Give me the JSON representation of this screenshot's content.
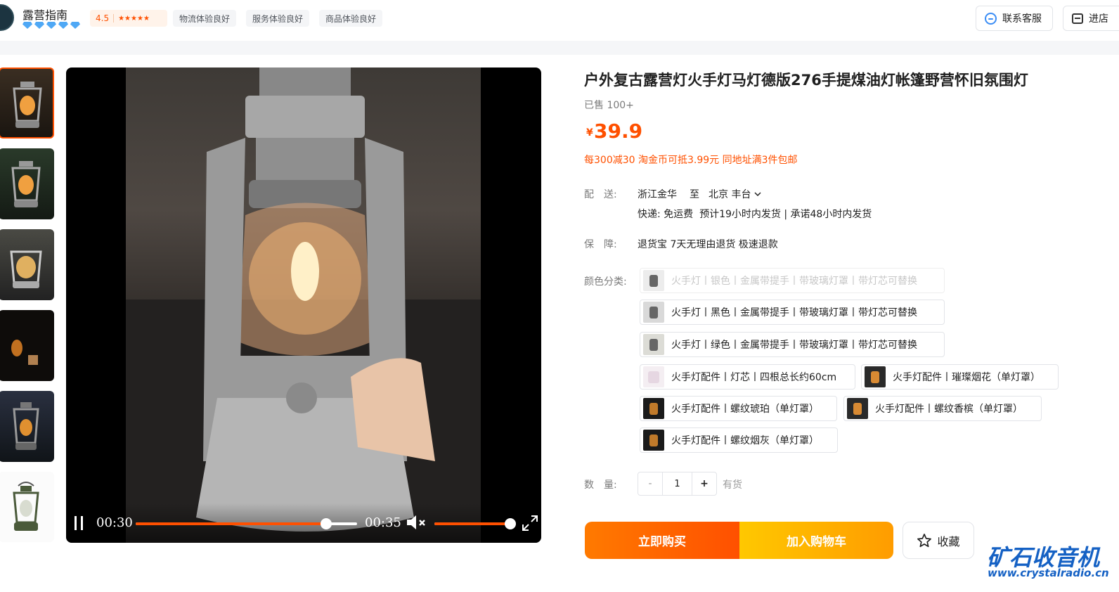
{
  "header": {
    "shop_name": "露营指南",
    "rating": "4.5",
    "stars": "★★★★★",
    "tags": [
      "物流体验良好",
      "服务体验良好",
      "商品体验良好"
    ],
    "contact_label": "联系客服",
    "enter_shop_label": "进店"
  },
  "video": {
    "current_time": "00:30",
    "duration": "00:35",
    "progress": 0.86,
    "volume": 1.0,
    "playing": true
  },
  "product": {
    "title": "户外复古露营灯火手灯马灯德版276手提煤油灯帐篷野营怀旧氛围灯",
    "sold": "已售 100+",
    "currency": "¥",
    "price": "39.9",
    "promo": "每300减30 淘金币可抵3.99元 同地址满3件包邮"
  },
  "delivery": {
    "label": "配　送:",
    "from": "浙江金华",
    "to_word": "至",
    "to": "北京 丰台",
    "detail": "快递: 免运费  预计19小时内发货 | 承诺48小时内发货"
  },
  "guarantee": {
    "label": "保　障:",
    "text": "退货宝 7天无理由退货 极速退款"
  },
  "color": {
    "label": "颜色分类:",
    "options": [
      "火手灯丨银色丨金属带提手丨带玻璃灯罩丨带灯芯可替换",
      "火手灯丨黑色丨金属带提手丨带玻璃灯罩丨带灯芯可替换",
      "火手灯丨绿色丨金属带提手丨带玻璃灯罩丨带灯芯可替换",
      "火手灯配件丨灯芯丨四根总长约60cm",
      "火手灯配件丨璀璨烟花（单灯罩）",
      "火手灯配件丨螺纹琥珀（单灯罩）",
      "火手灯配件丨螺纹香槟（单灯罩）",
      "火手灯配件丨螺纹烟灰（单灯罩）"
    ],
    "disabled_index": 0
  },
  "quantity": {
    "label": "数　量:",
    "minus": "-",
    "value": "1",
    "plus": "+",
    "stock": "有货"
  },
  "actions": {
    "buy_now": "立即购买",
    "add_cart": "加入购物车",
    "favorite": "收藏"
  },
  "watermark": {
    "line1": "矿石收音机",
    "line2": "www.crystalradio.cn"
  },
  "colors": {
    "accent": "#ff5000",
    "buy_gradient": [
      "#ff7a00",
      "#ff5000"
    ],
    "cart_gradient": [
      "#ffc800",
      "#ff9c00"
    ],
    "watermark": "#1561c4"
  }
}
